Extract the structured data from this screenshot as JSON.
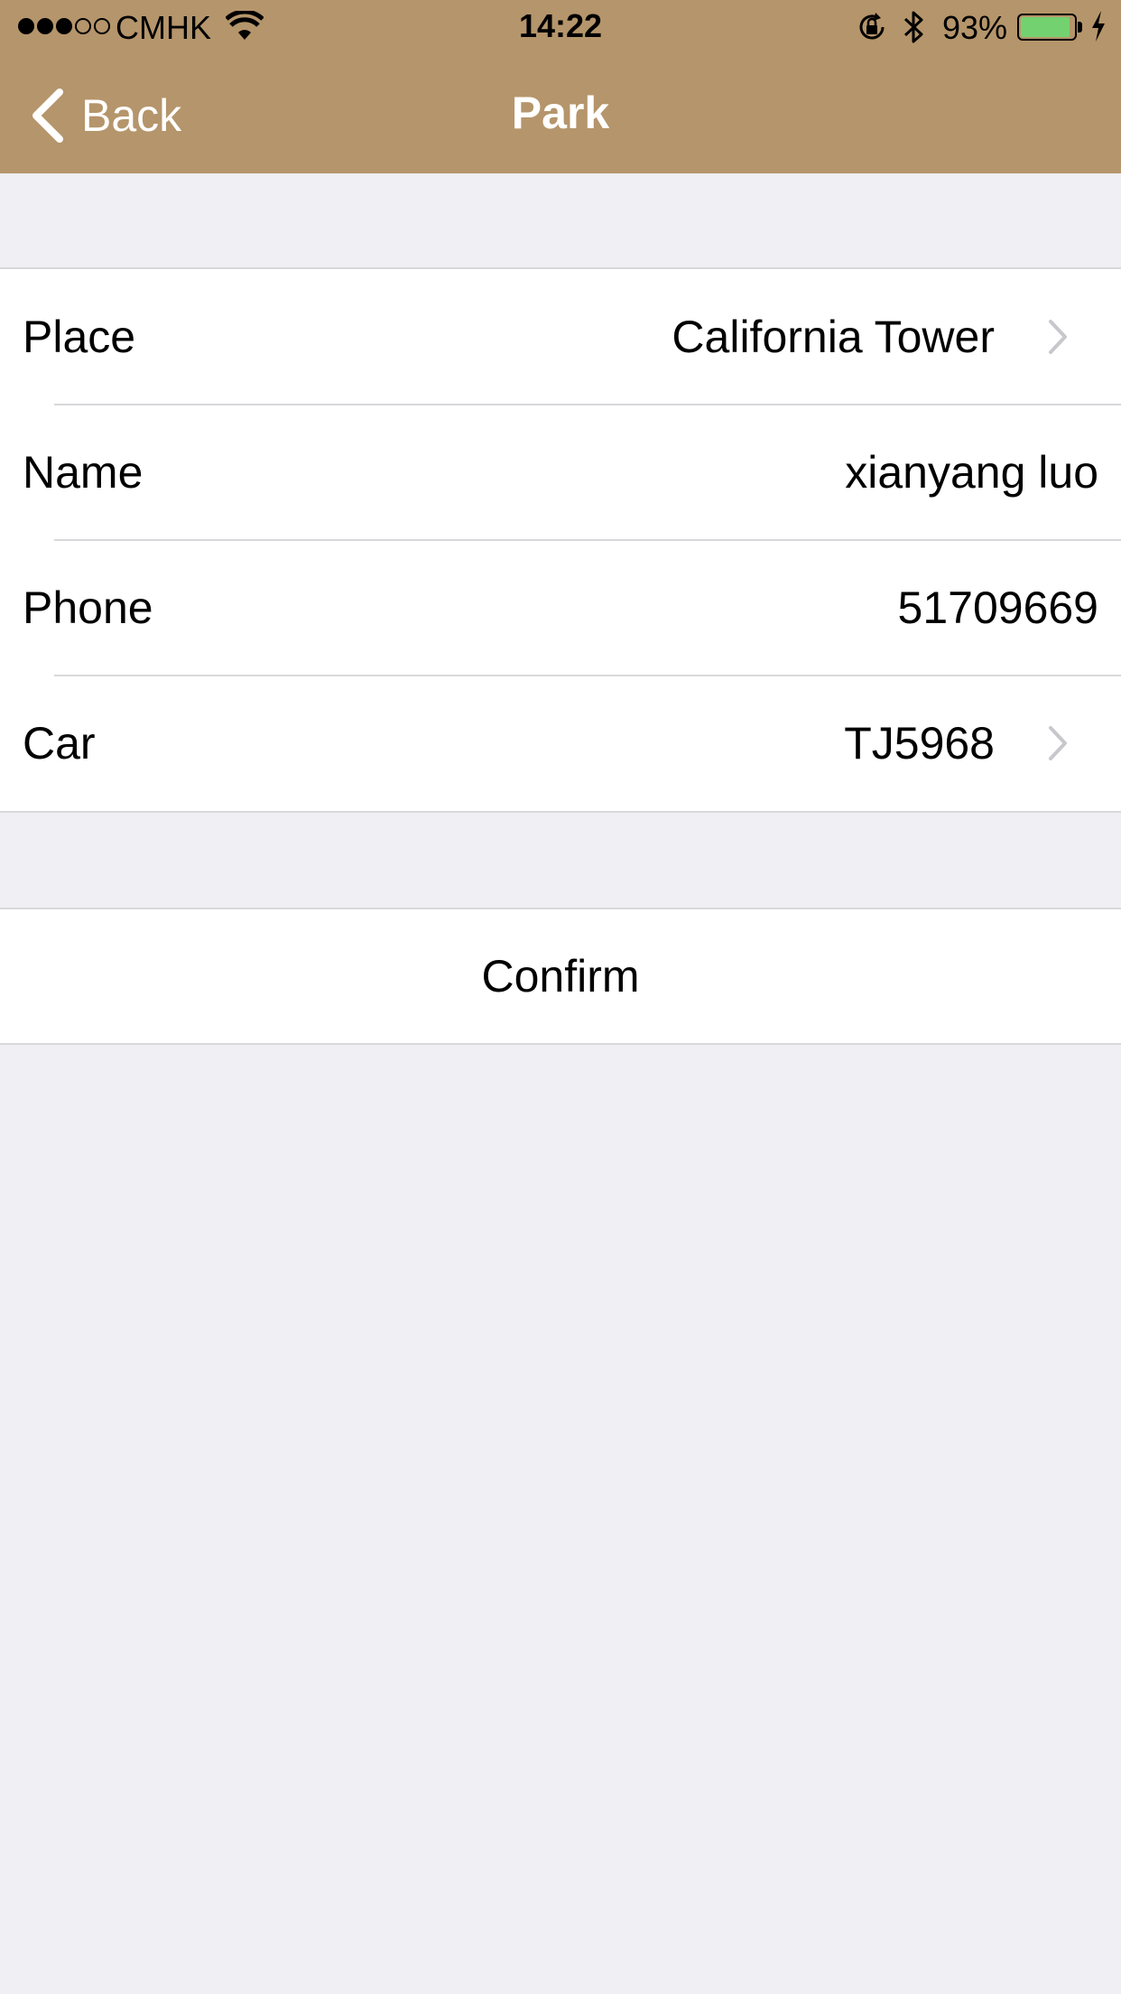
{
  "status_bar": {
    "carrier": "CMHK",
    "signal_bars_filled": 3,
    "signal_bars_total": 5,
    "time": "14:22",
    "battery_percent_label": "93%",
    "battery_level": 0.93,
    "battery_color": "#73d26f"
  },
  "nav": {
    "back_label": "Back",
    "title": "Park",
    "bar_color": "#b5956b"
  },
  "form": {
    "rows": [
      {
        "label": "Place",
        "value": "California Tower",
        "has_chevron": true
      },
      {
        "label": "Name",
        "value": "xianyang luo",
        "has_chevron": false
      },
      {
        "label": "Phone",
        "value": "51709669",
        "has_chevron": false
      },
      {
        "label": "Car",
        "value": "TJ5968",
        "has_chevron": true
      }
    ]
  },
  "confirm": {
    "label": "Confirm"
  },
  "icons": {
    "wifi": "wifi-icon",
    "rotation_lock": "rotation-lock-icon",
    "bluetooth": "bluetooth-icon",
    "charging": "charging-bolt-icon",
    "back": "chevron-left-icon",
    "disclosure": "chevron-right-icon"
  }
}
